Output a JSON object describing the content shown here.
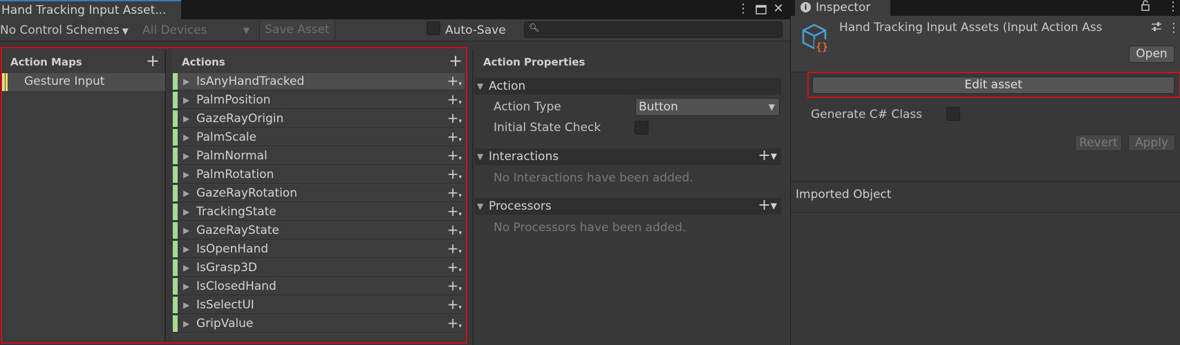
{
  "editor": {
    "tab_title": "Hand Tracking Input Asset...",
    "icons": [
      "kebab-menu-icon",
      "maximize-icon",
      "close-icon"
    ],
    "toolbar": {
      "control_schemes": "No Control Schemes",
      "devices": "All Devices",
      "save_asset": "Save Asset",
      "auto_save": "Auto-Save",
      "search_placeholder": ""
    },
    "action_maps": {
      "header": "Action Maps",
      "items": [
        "Gesture Input"
      ]
    },
    "actions": {
      "header": "Actions",
      "items": [
        "IsAnyHandTracked",
        "PalmPosition",
        "GazeRayOrigin",
        "PalmScale",
        "PalmNormal",
        "PalmRotation",
        "GazeRayRotation",
        "TrackingState",
        "GazeRayState",
        "IsOpenHand",
        "IsGrasp3D",
        "IsClosedHand",
        "IsSelectUI",
        "GripValue"
      ]
    },
    "properties": {
      "header": "Action Properties",
      "action_section": "Action",
      "action_type_label": "Action Type",
      "action_type_value": "Button",
      "initial_state_label": "Initial State Check",
      "interactions_section": "Interactions",
      "interactions_empty": "No Interactions have been added.",
      "processors_section": "Processors",
      "processors_empty": "No Processors have been added."
    }
  },
  "inspector": {
    "tab_title": "Inspector",
    "asset_title": "Hand Tracking Input Assets (Input Action Ass",
    "open": "Open",
    "edit_asset": "Edit asset",
    "generate_class": "Generate C# Class",
    "revert": "Revert",
    "apply": "Apply",
    "imported_object": "Imported Object"
  },
  "colors": {
    "action_map_accent": "#f2da76",
    "action_accent": "#a4dc94",
    "highlight_box": "#d0111b"
  }
}
